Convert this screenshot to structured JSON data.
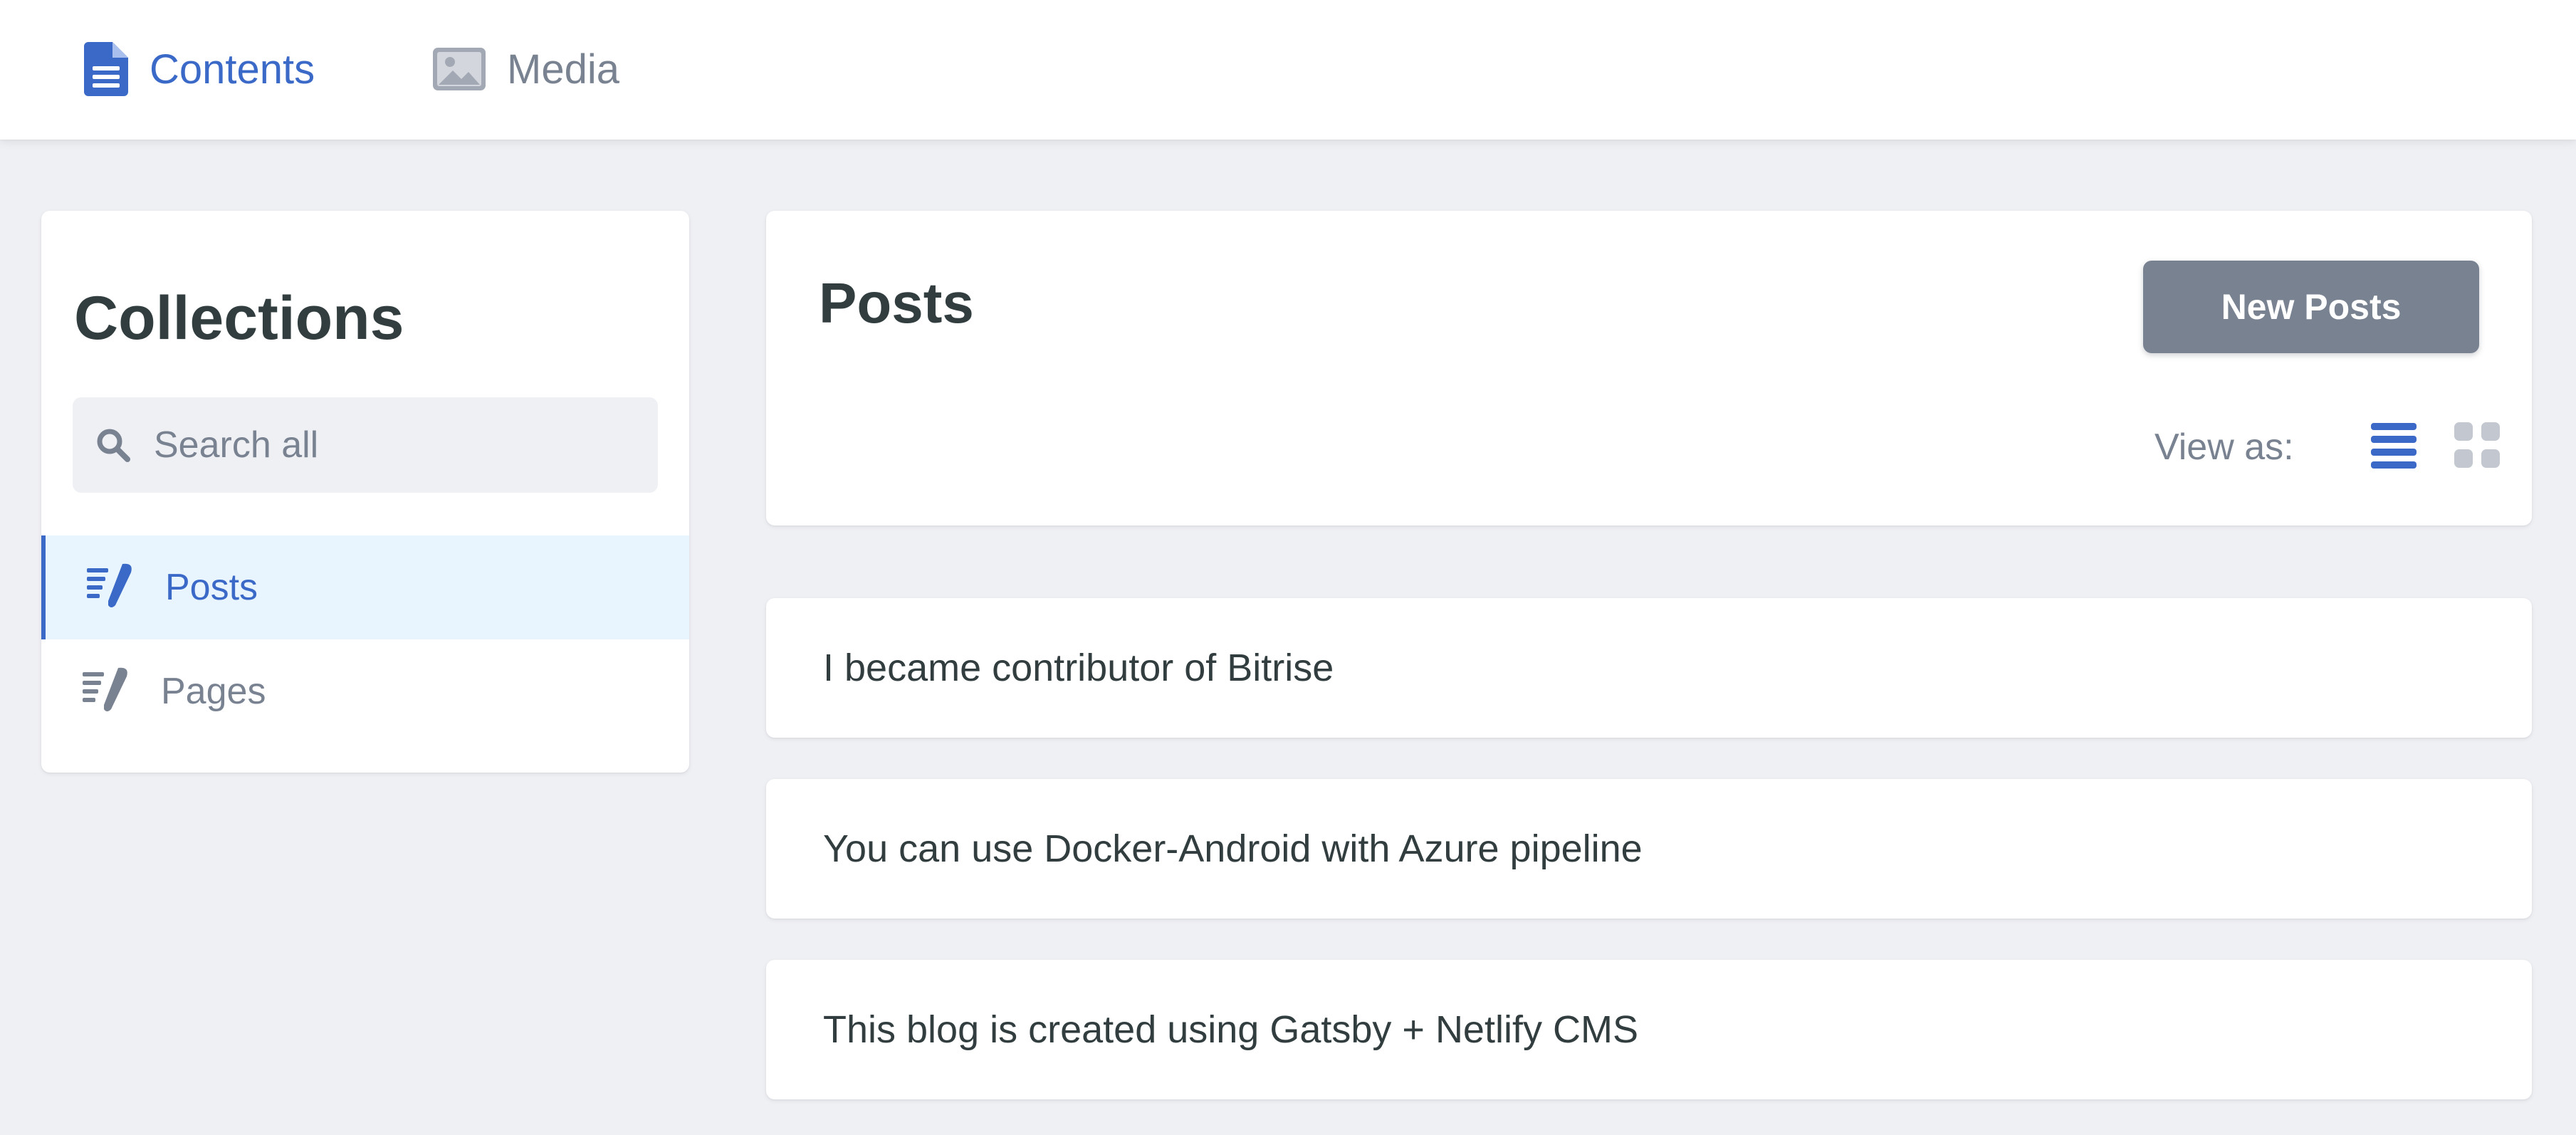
{
  "nav": {
    "contents": {
      "label": "Contents",
      "icon": "document-icon"
    },
    "media": {
      "label": "Media",
      "icon": "image-icon"
    }
  },
  "sidebar": {
    "title": "Collections",
    "search": {
      "placeholder": "Search all",
      "value": "",
      "icon": "search-icon"
    },
    "collections": [
      {
        "label": "Posts",
        "icon": "write-icon",
        "active": true
      },
      {
        "label": "Pages",
        "icon": "write-icon",
        "active": false
      }
    ]
  },
  "main": {
    "title": "Posts",
    "new_button_label": "New Posts",
    "view_as_label": "View as:",
    "view_modes": [
      {
        "name": "list",
        "icon": "list-icon",
        "active": true
      },
      {
        "name": "grid",
        "icon": "grid-icon",
        "active": false
      }
    ],
    "entries": [
      "I became contributor of Bitrise",
      "You can use Docker-Android with Azure pipeline",
      "This blog is created using Gatsby + Netlify CMS"
    ]
  },
  "colors": {
    "accent": "#3a69c7",
    "muted": "#798291",
    "background": "#eff0f4",
    "active_item_bg": "#e8f5fe",
    "text": "#313d3e"
  }
}
